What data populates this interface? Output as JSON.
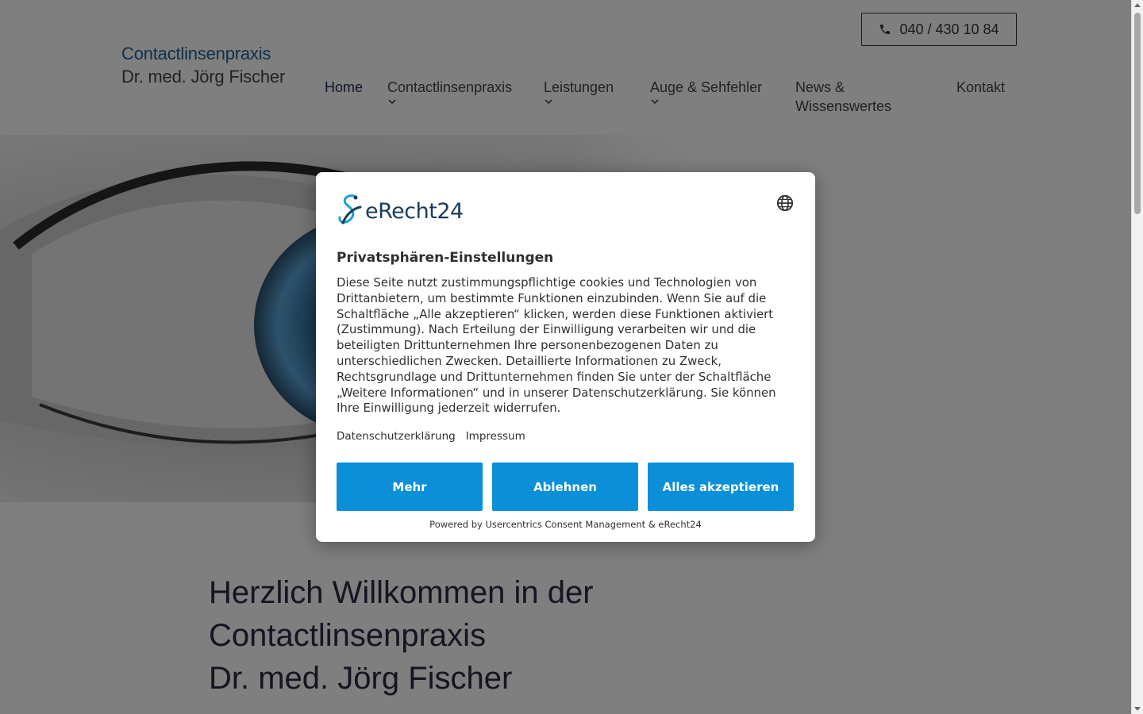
{
  "brand": {
    "line1": "Contactlinsenpraxis",
    "line2": "Dr. med. Jörg Fischer"
  },
  "header": {
    "phone": "040 / 430 10 84",
    "phone_icon": "phone-icon"
  },
  "nav": {
    "home": "Home",
    "contactlinsenpraxis": "Contactlinsenpraxis",
    "leistungen": "Leistungen",
    "auge": "Auge & Sehfehler",
    "news_line1": "News &",
    "news_line2": "Wissenswertes",
    "kontakt": "Kontakt"
  },
  "welcome": {
    "line1": "Herzlich Willkommen in der",
    "line2": "Contactlinsenpraxis",
    "line3": "Dr. med. Jörg Fischer"
  },
  "consent": {
    "logo_text": "eRecht24",
    "title": "Privatsphären-Einstellungen",
    "body": "Diese Seite nutzt zustimmungspflichtige cookies und Technologien von Drittanbietern, um bestimmte Funktionen einzubinden. Wenn Sie auf die Schaltfläche „Alle akzeptieren“ klicken, werden diese Funktionen aktiviert (Zustimmung). Nach Erteilung der Einwilligung verarbeiten wir und die beteiligten Drittunternehmen Ihre personenbezogenen Daten zu unterschiedlichen Zwecken. Detaillierte Informationen zu Zweck, Rechtsgrundlage und Drittunternehmen finden Sie unter der Schaltfläche „Weitere Informationen“ und in unserer Datenschutzerklärung. Sie können Ihre Einwilligung jederzeit widerrufen.",
    "link_privacy": "Datenschutzerklärung",
    "link_imprint": "Impressum",
    "btn_more": "Mehr",
    "btn_reject": "Ablehnen",
    "btn_accept": "Alles akzeptieren",
    "powered": "Powered by Usercentrics Consent Management & eRecht24",
    "button_color": "#0a8fd8"
  }
}
